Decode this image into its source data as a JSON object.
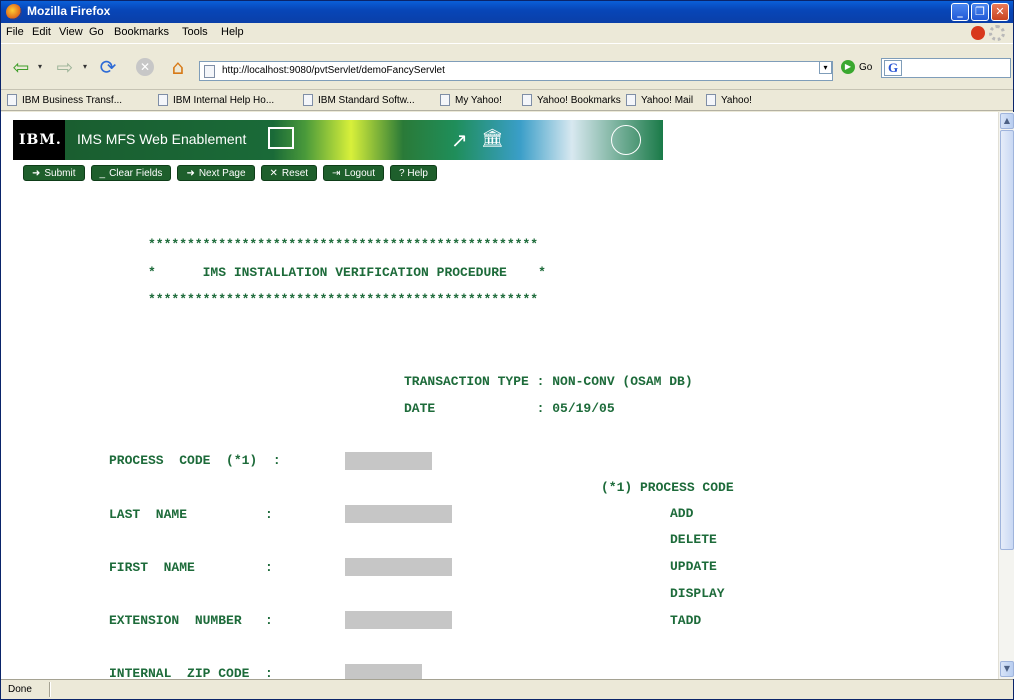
{
  "window": {
    "title": "Mozilla Firefox"
  },
  "menu": [
    "File",
    "Edit",
    "View",
    "Go",
    "Bookmarks",
    "Tools",
    "Help"
  ],
  "toolbar": {
    "url": "http://localhost:9080/pvtServlet/demoFancyServlet",
    "go_label": "Go"
  },
  "bookmarks": [
    "IBM Business Transf...",
    "IBM Internal Help Ho...",
    "IBM Standard Softw...",
    "My Yahoo!",
    "Yahoo! Bookmarks",
    "Yahoo! Mail",
    "Yahoo!"
  ],
  "banner": {
    "logo": "IBM.",
    "product": "IMS MFS Web Enablement"
  },
  "actions": {
    "submit": "Submit",
    "clear": "Clear Fields",
    "next": "Next Page",
    "reset": "Reset",
    "logout": "Logout",
    "help": "? Help"
  },
  "form": {
    "stars_line": "**************************************************",
    "title_line": "*      IMS INSTALLATION VERIFICATION PROCEDURE    *",
    "transaction_line": "TRANSACTION TYPE : NON-CONV (OSAM DB)",
    "date_line": "DATE             : 05/19/05",
    "process_code_label": "PROCESS  CODE  (*1)  :",
    "last_name_label": "LAST  NAME          :",
    "first_name_label": "FIRST  NAME         :",
    "extension_label": "EXTENSION  NUMBER   :",
    "zip_label": "INTERNAL  ZIP CODE  :",
    "legend_title": "(*1) PROCESS CODE",
    "codes": [
      "ADD",
      "DELETE",
      "UPDATE",
      "DISPLAY",
      "TADD"
    ]
  },
  "status": {
    "text": "Done"
  }
}
